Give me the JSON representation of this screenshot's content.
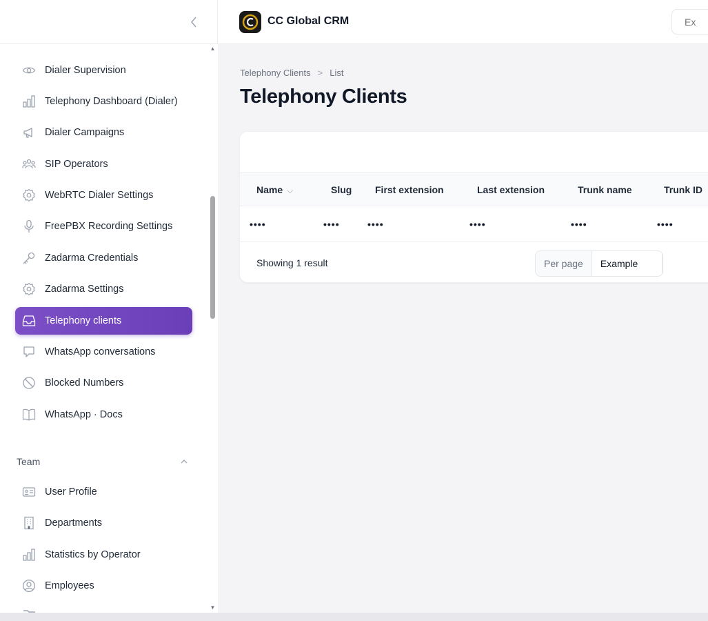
{
  "header": {
    "app_title": "CC Global CRM",
    "search_placeholder": "Ex"
  },
  "sidebar": {
    "items": [
      {
        "label": "Dialer Supervision",
        "icon": "eye-icon"
      },
      {
        "label": "Telephony Dashboard (Dialer)",
        "icon": "bar-chart-icon"
      },
      {
        "label": "Dialer Campaigns",
        "icon": "megaphone-icon"
      },
      {
        "label": "SIP Operators",
        "icon": "users-group-icon"
      },
      {
        "label": "WebRTC Dialer Settings",
        "icon": "gear-icon"
      },
      {
        "label": "FreePBX Recording Settings",
        "icon": "microphone-icon"
      },
      {
        "label": "Zadarma Credentials",
        "icon": "key-icon"
      },
      {
        "label": "Zadarma Settings",
        "icon": "gear-icon"
      },
      {
        "label": "Telephony clients",
        "icon": "inbox-icon",
        "active": true
      },
      {
        "label": "WhatsApp conversations",
        "icon": "chat-icon"
      },
      {
        "label": "Blocked Numbers",
        "icon": "no-symbol-icon"
      },
      {
        "label": "WhatsApp · Docs",
        "icon": "book-icon"
      }
    ],
    "team_group": {
      "label": "Team",
      "items": [
        {
          "label": "User Profile",
          "icon": "id-card-icon"
        },
        {
          "label": "Departments",
          "icon": "building-icon"
        },
        {
          "label": "Statistics by Operator",
          "icon": "bar-chart-icon"
        },
        {
          "label": "Employees",
          "icon": "user-circle-icon"
        }
      ]
    }
  },
  "main": {
    "breadcrumb": [
      "Telephony Clients",
      "List"
    ],
    "title": "Telephony Clients",
    "table": {
      "columns": [
        "Name",
        "Slug",
        "First extension",
        "Last extension",
        "Trunk name",
        "Trunk ID"
      ],
      "rows": [
        [
          "••••",
          "••••",
          "••••",
          "••••",
          "••••",
          "••••"
        ]
      ],
      "footer": {
        "showing": "Showing 1 result",
        "per_page_label": "Per page",
        "per_page_value": "Example"
      }
    }
  },
  "colors": {
    "accent": "#6a3fb8",
    "background": "#f4f4f7"
  }
}
